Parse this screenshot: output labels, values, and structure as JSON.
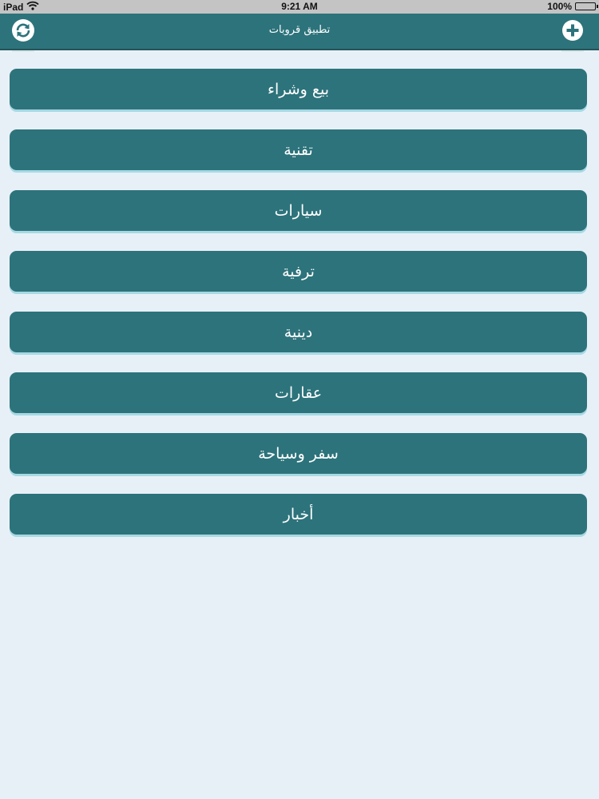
{
  "status_bar": {
    "device": "iPad",
    "time": "9:21 AM",
    "battery": "100%",
    "icons": [
      "wifi-icon",
      "battery-icon"
    ]
  },
  "nav_bar": {
    "title": "تطبيق قروبات",
    "left_icon": "refresh-icon",
    "right_icon": "add-icon",
    "background": "#2d737b"
  },
  "categories": [
    {
      "label": "بيع وشراء"
    },
    {
      "label": "تقنية"
    },
    {
      "label": "سيارات"
    },
    {
      "label": "ترفية"
    },
    {
      "label": "دينية"
    },
    {
      "label": "عقارات"
    },
    {
      "label": "سفر وسياحة"
    },
    {
      "label": "أخبار"
    }
  ],
  "colors": {
    "accent": "#2d737b",
    "page_background": "#e8f0f7",
    "button_text": "#ffffff"
  }
}
